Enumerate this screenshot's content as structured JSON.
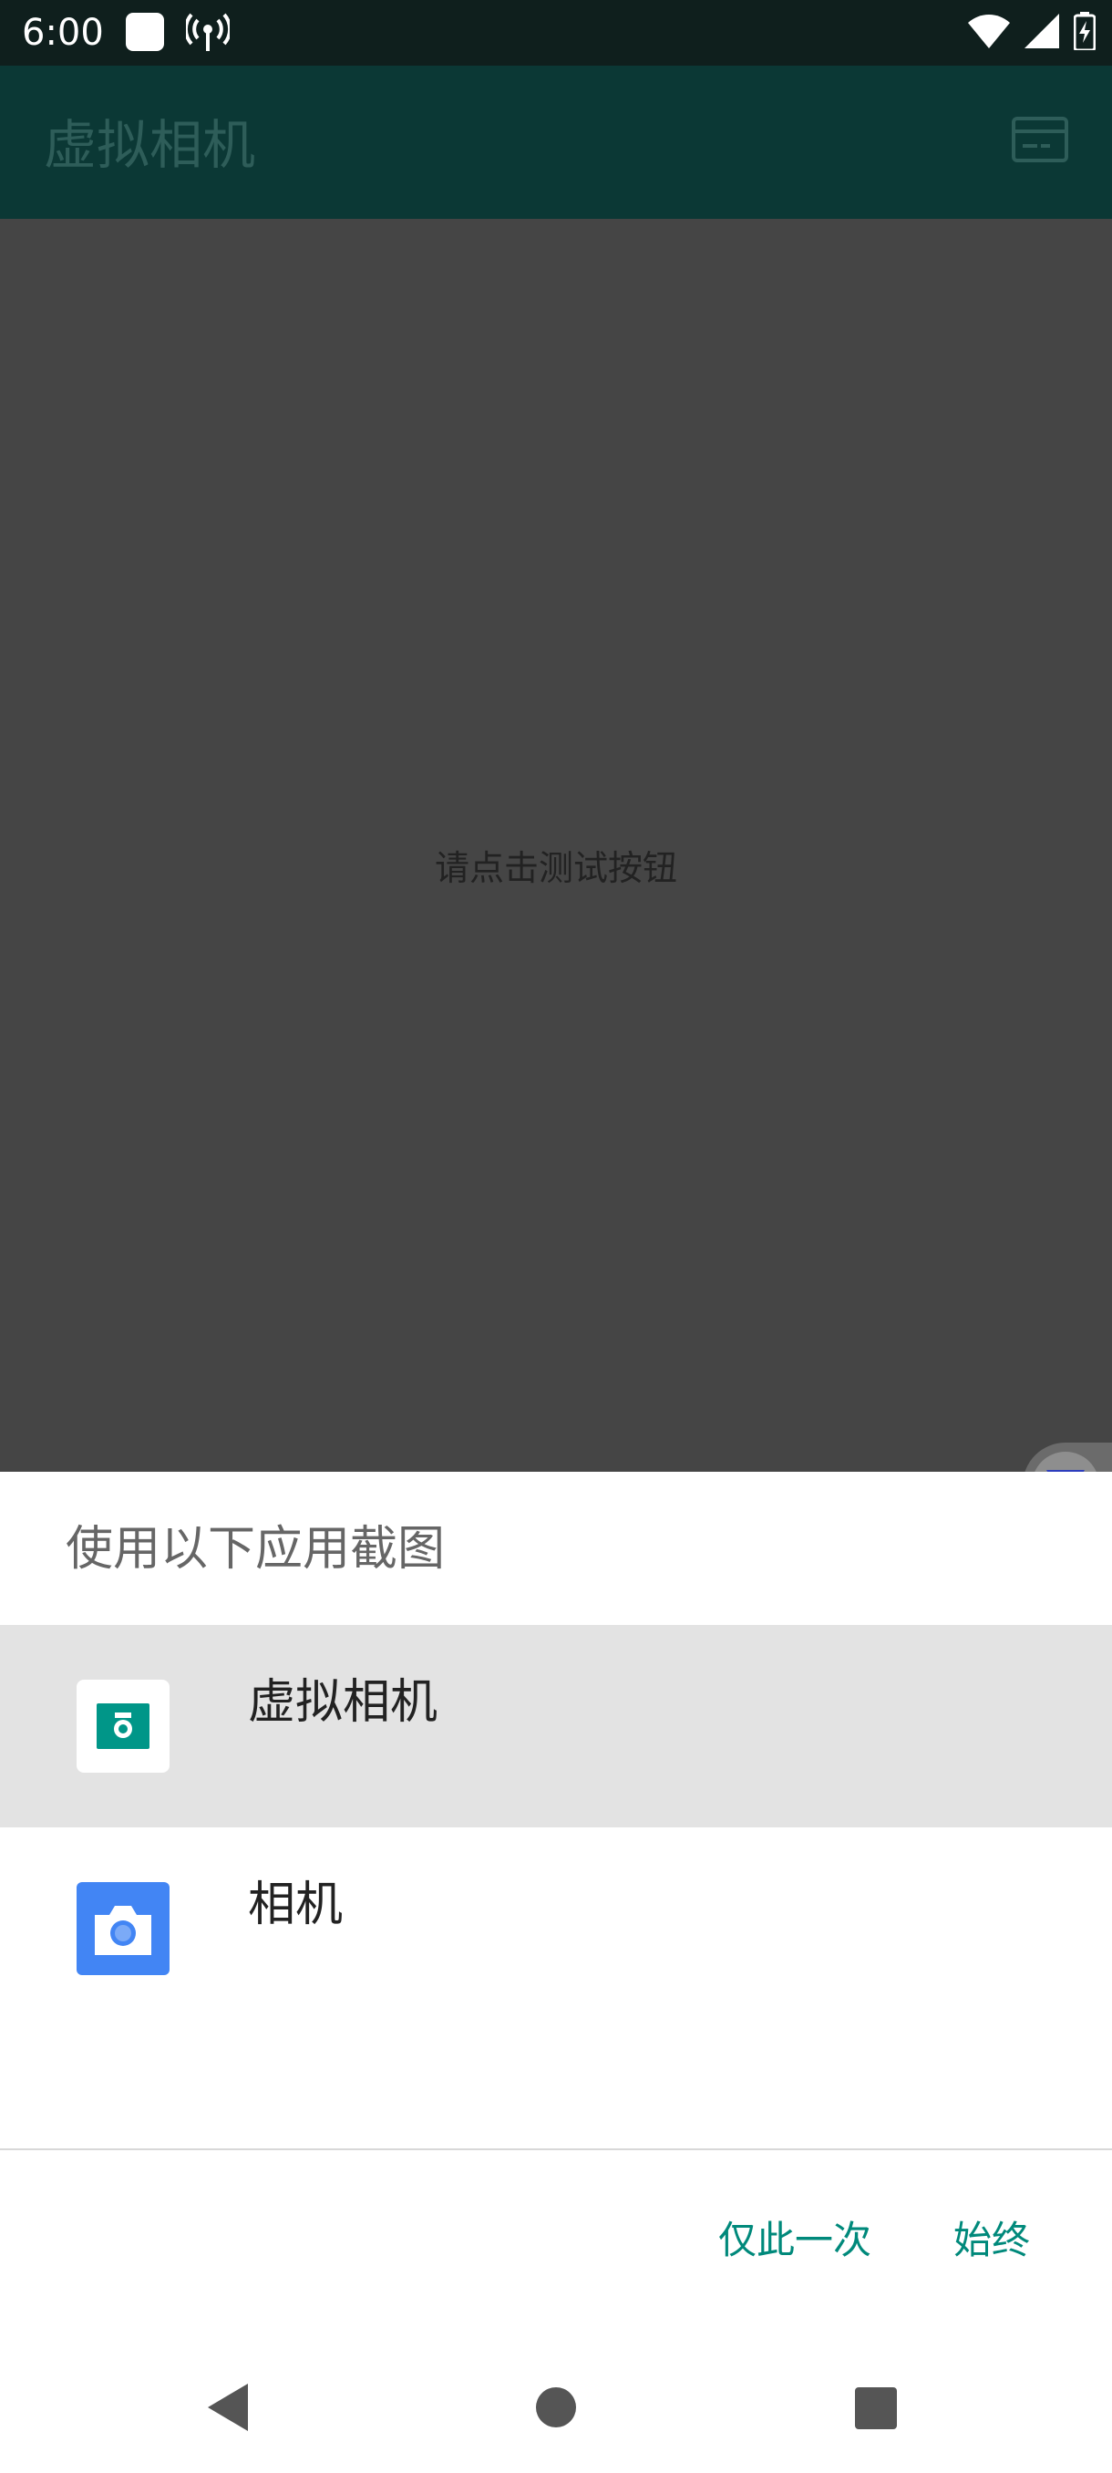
{
  "status_bar": {
    "time": "6:00",
    "icons": [
      "notification-icon",
      "hotspot-icon",
      "wifi-icon",
      "signal-icon",
      "battery-icon"
    ]
  },
  "app_bar": {
    "title": "虚拟相机",
    "menu_icon": "card-icon"
  },
  "content": {
    "hint": "请点击测试按钮",
    "floating_button_icon": "v-logo-icon"
  },
  "chooser": {
    "title": "使用以下应用截图",
    "options": [
      {
        "label": "虚拟相机",
        "icon": "camera-app-icon",
        "selected": true,
        "icon_color": "#009688"
      },
      {
        "label": "相机",
        "icon": "camera-icon",
        "selected": false,
        "icon_color": "#4285f4"
      }
    ],
    "buttons": {
      "just_once": "仅此一次",
      "always": "始终"
    },
    "accent_color": "#00897b"
  },
  "nav_bar": {
    "icons": [
      "back-icon",
      "home-icon",
      "recents-icon"
    ]
  }
}
